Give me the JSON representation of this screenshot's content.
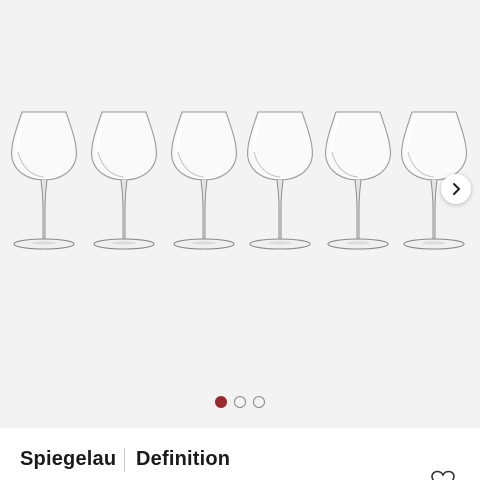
{
  "gallery": {
    "image_description_icon": "wine-glass-icon",
    "glass_count": 6,
    "next_icon": "chevron-right-icon",
    "slides": [
      {
        "active": true
      },
      {
        "active": false
      },
      {
        "active": false
      }
    ],
    "colors": {
      "background": "#f3f3f3",
      "active_dot": "#9b2a2f",
      "inactive_dot_border": "#8a8a8a"
    }
  },
  "product": {
    "brand": "Spiegelau",
    "name": "Definition",
    "wishlist_icon": "heart-icon"
  }
}
